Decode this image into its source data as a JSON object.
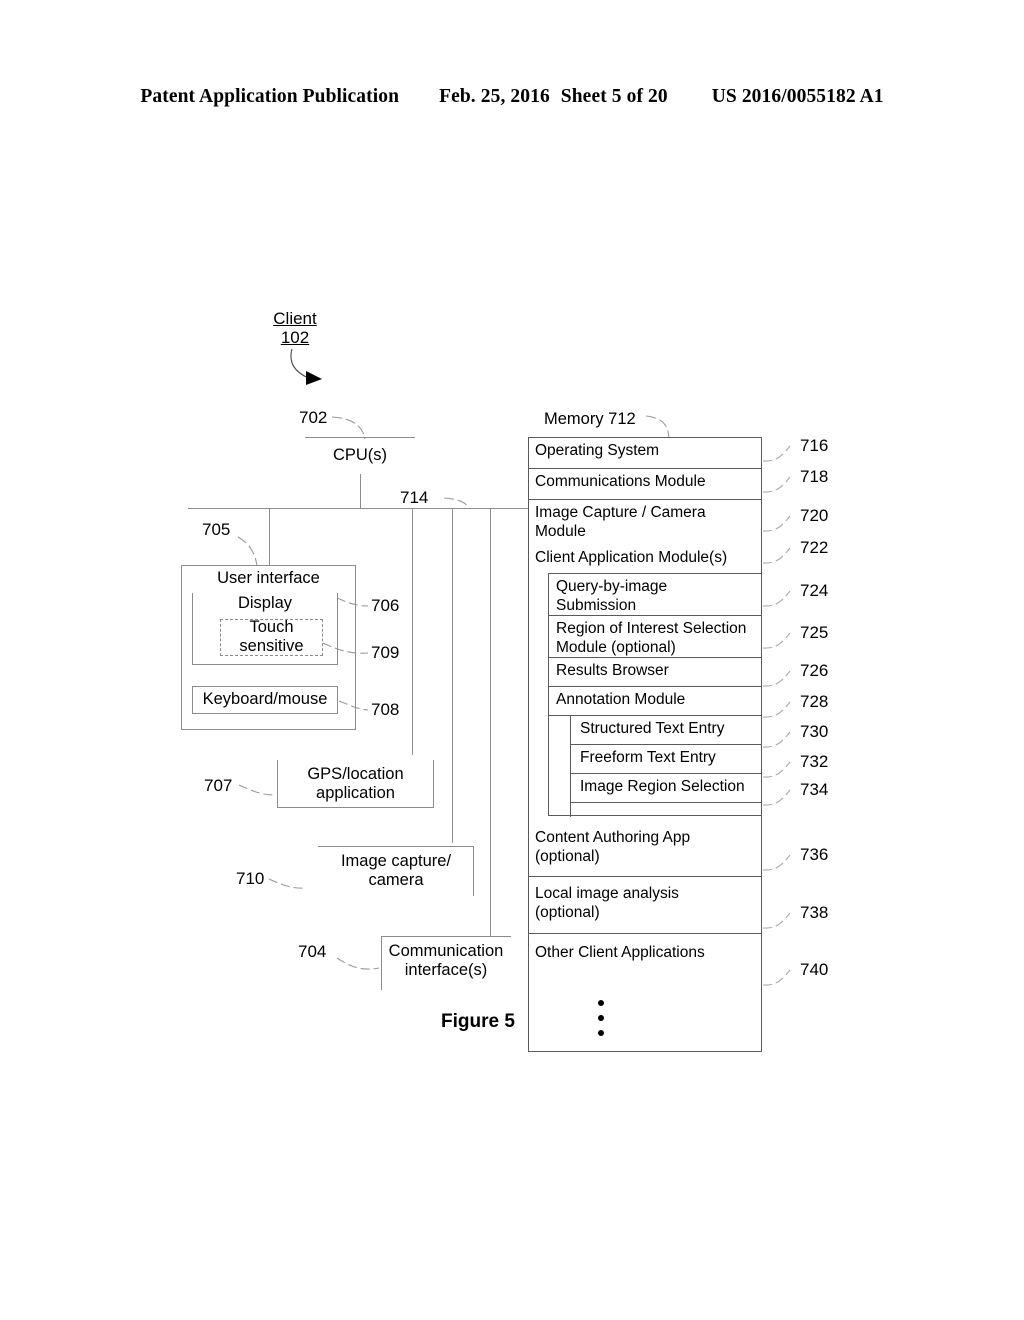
{
  "header": {
    "publication": "Patent Application Publication",
    "date": "Feb. 25, 2016",
    "sheet": "Sheet 5 of 20",
    "number": "US 2016/0055182 A1"
  },
  "figure": {
    "caption": "Figure 5"
  },
  "callout": {
    "title": "Client",
    "ref": "102"
  },
  "cpu": {
    "label": "CPU(s)",
    "ref": "702"
  },
  "bus": {
    "ref": "714"
  },
  "user_interface": {
    "label": "User interface",
    "ref": "705",
    "display": {
      "label": "Display",
      "ref": "706"
    },
    "touch": {
      "label": "Touch\nsensitive",
      "ref": "709"
    },
    "keyboard": {
      "label": "Keyboard/mouse",
      "ref": "708"
    }
  },
  "gps": {
    "label": "GPS/location\napplication",
    "ref": "707"
  },
  "image_capture": {
    "label": "Image capture/\ncamera",
    "ref": "710"
  },
  "comm_interface": {
    "label": "Communication\ninterface(s)",
    "ref": "704"
  },
  "memory": {
    "label": "Memory 712",
    "rows": [
      {
        "label": "Operating System",
        "ref": "716"
      },
      {
        "label": "Communications Module",
        "ref": "718"
      },
      {
        "label": "Image Capture / Camera\nModule",
        "ref": "720"
      },
      {
        "label": "Client Application Module(s)",
        "ref": "722"
      },
      {
        "label": "Query-by-image\nSubmission",
        "ref": "724"
      },
      {
        "label": "Region of Interest Selection\nModule (optional)",
        "ref": "725"
      },
      {
        "label": "Results Browser",
        "ref": "726"
      },
      {
        "label": "Annotation Module",
        "ref": "728"
      },
      {
        "label": "Structured Text Entry",
        "ref": "730"
      },
      {
        "label": "Freeform Text Entry",
        "ref": "732"
      },
      {
        "label": "Image Region Selection",
        "ref": "734"
      },
      {
        "label": "Content Authoring App\n(optional)",
        "ref": "736"
      },
      {
        "label": "Local image analysis\n(optional)",
        "ref": "738"
      },
      {
        "label": "Other Client Applications",
        "ref": "740"
      }
    ]
  }
}
